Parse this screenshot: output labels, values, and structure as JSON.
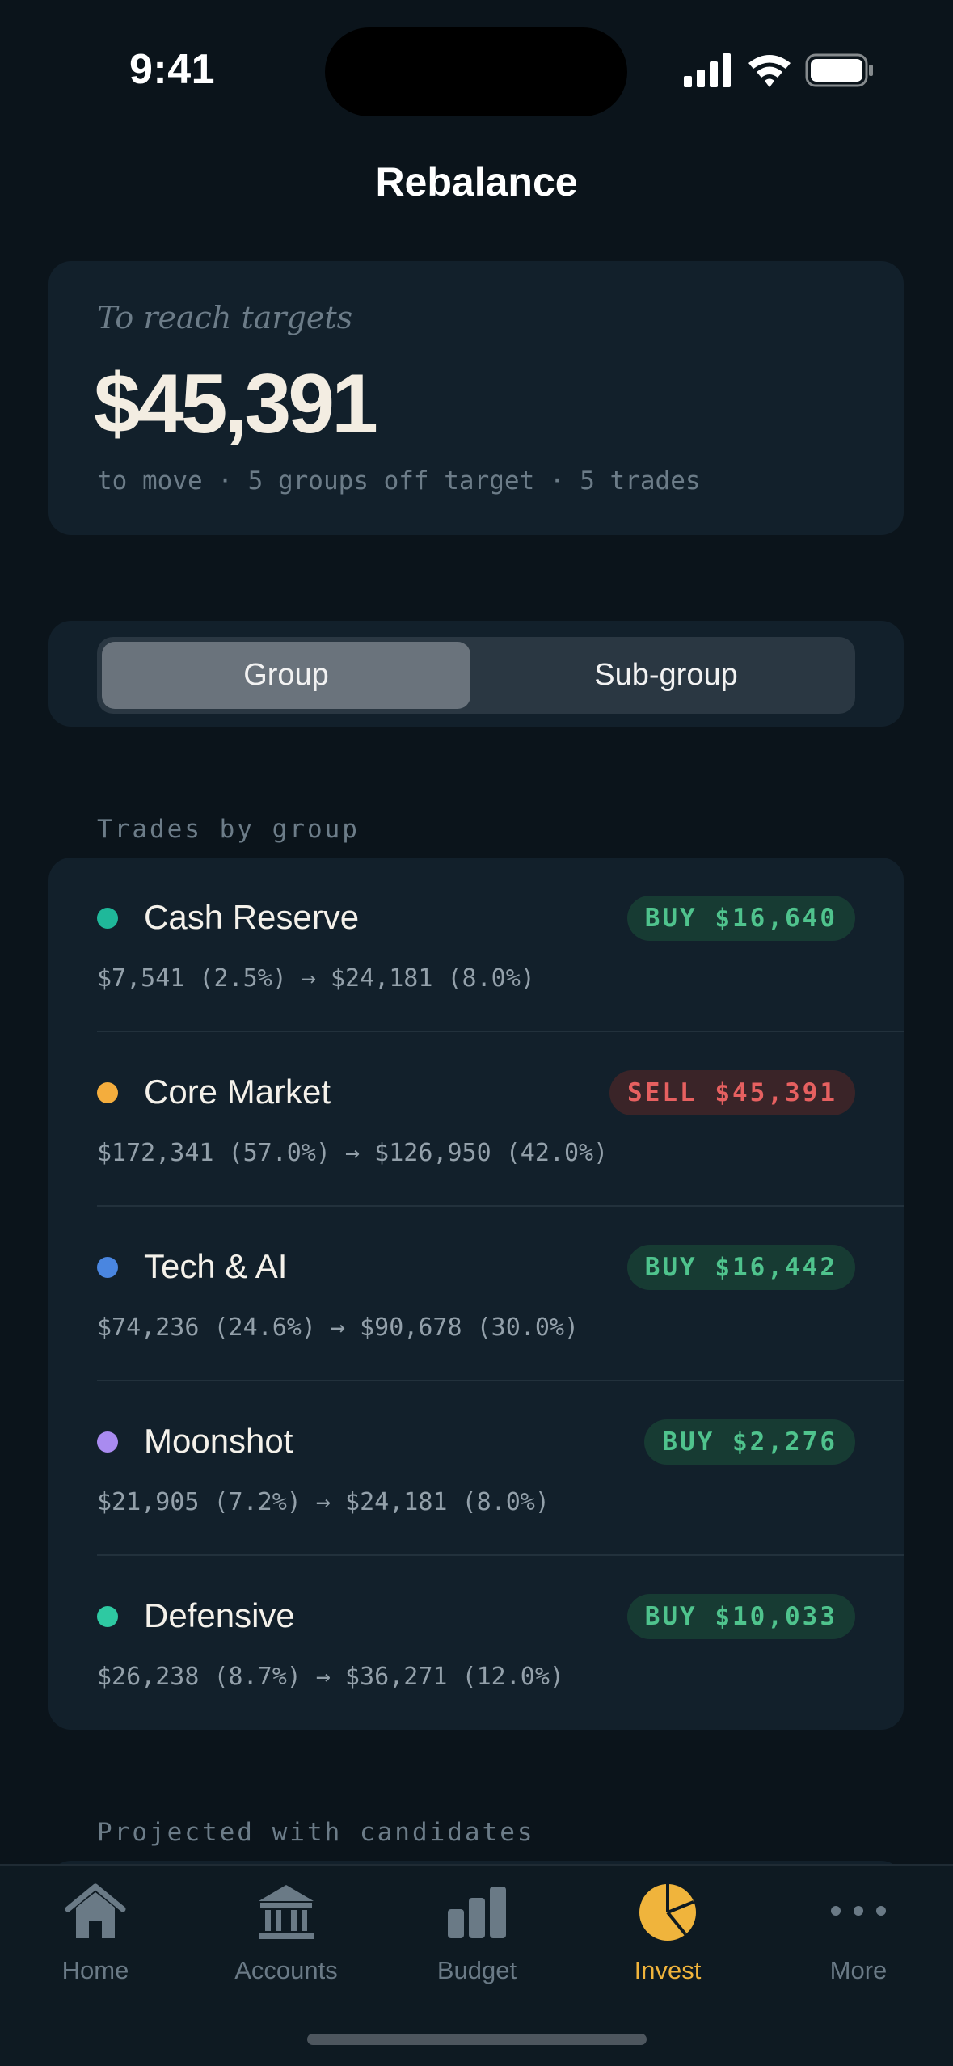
{
  "status_bar": {
    "time": "9:41"
  },
  "page_title": "Rebalance",
  "summary": {
    "kicker": "To reach targets",
    "amount": "$45,391",
    "meta": "to move · 5 groups off target · 5 trades"
  },
  "segmented": {
    "options": [
      "Group",
      "Sub-group"
    ],
    "selected": "Group"
  },
  "trades_section_label": "Trades by group",
  "trades": [
    {
      "name": "Cash Reserve",
      "action": "BUY $16,640",
      "detail": "$7,541 (2.5%) → $24,181 (8.0%)",
      "dot_color": "#1fb89a",
      "side": "buy"
    },
    {
      "name": "Core Market",
      "action": "SELL $45,391",
      "detail": "$172,341 (57.0%) → $126,950 (42.0%)",
      "dot_color": "#f4ad3d",
      "side": "sell"
    },
    {
      "name": "Tech & AI",
      "action": "BUY $16,442",
      "detail": "$74,236 (24.6%) → $90,678 (30.0%)",
      "dot_color": "#4a86e0",
      "side": "buy"
    },
    {
      "name": "Moonshot",
      "action": "BUY $2,276",
      "detail": "$21,905 (7.2%) → $24,181 (8.0%)",
      "dot_color": "#a98bf0",
      "side": "buy"
    },
    {
      "name": "Defensive",
      "action": "BUY $10,033",
      "detail": "$26,238 (8.7%) → $36,271 (12.0%)",
      "dot_color": "#2ec9a2",
      "side": "buy"
    }
  ],
  "projected_section_label": "Projected with candidates",
  "tabbar": {
    "items": [
      {
        "label": "Home",
        "icon": "home-icon"
      },
      {
        "label": "Accounts",
        "icon": "bank-icon"
      },
      {
        "label": "Budget",
        "icon": "bar-chart-icon"
      },
      {
        "label": "Invest",
        "icon": "pie-chart-icon"
      },
      {
        "label": "More",
        "icon": "more-dots-icon"
      }
    ],
    "active": "Invest"
  },
  "colors": {
    "background": "#0b141b",
    "card": "#12202b",
    "accent": "#f0b43c",
    "buy": "#4fc38d",
    "sell": "#e66060"
  }
}
